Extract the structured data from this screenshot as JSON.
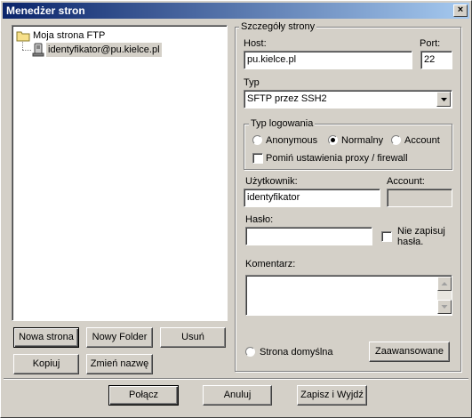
{
  "window": {
    "title": "Menedżer stron"
  },
  "tree": {
    "root_label": "Moja strona FTP",
    "items": [
      {
        "label": "identyfikator@pu.kielce.pl",
        "selected": true
      }
    ]
  },
  "left_buttons": {
    "new_site": "Nowa strona",
    "new_folder": "Nowy Folder",
    "delete": "Usuń",
    "copy": "Kopiuj",
    "rename": "Zmień nazwę"
  },
  "details": {
    "group_title": "Szczegóły strony",
    "host_label": "Host:",
    "host_value": "pu.kielce.pl",
    "port_label": "Port:",
    "port_value": "22",
    "type_label": "Typ",
    "type_value": "SFTP przez SSH2",
    "login_group_title": "Typ logowania",
    "login_options": [
      "Anonymous",
      "Normalny",
      "Account"
    ],
    "login_selected": "Normalny",
    "skip_proxy_label": "Pomiń ustawienia proxy / firewall",
    "skip_proxy_checked": false,
    "user_label": "Użytkownik:",
    "user_value": "identyfikator",
    "account_label": "Account:",
    "account_value": "",
    "password_label": "Hasło:",
    "password_value": "",
    "dont_save_label_1": "Nie zapisuj",
    "dont_save_label_2": "hasła.",
    "dont_save_checked": false,
    "comment_label": "Komentarz:",
    "comment_value": "",
    "default_site_label": "Strona domyślna",
    "default_site_checked": false,
    "advanced_button": "Zaawansowane"
  },
  "bottom_buttons": {
    "connect": "Połącz",
    "cancel": "Anuluj",
    "save_exit": "Zapisz i Wyjdź"
  },
  "colors": {
    "titlebar_start": "#0a246a",
    "titlebar_end": "#a6caf0",
    "selection": "#d4d0c8",
    "face": "#d4d0c8"
  }
}
